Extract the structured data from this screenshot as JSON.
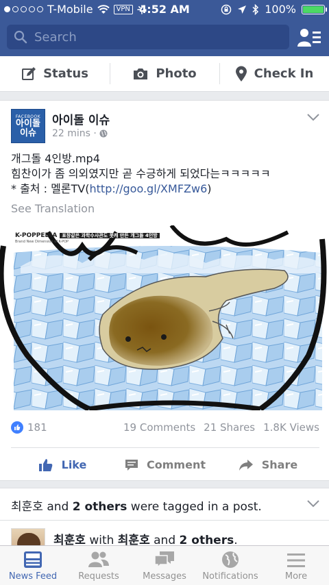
{
  "status_bar": {
    "carrier": "T-Mobile",
    "vpn": "VPN",
    "time": "4:52 AM",
    "battery": "100%"
  },
  "search": {
    "placeholder": "Search"
  },
  "composer": {
    "status": "Status",
    "photo": "Photo",
    "check_in": "Check In"
  },
  "post": {
    "avatar_lines": [
      "FACEBOOK",
      "아이돌",
      "이슈"
    ],
    "page_name": "아이돌 이슈",
    "time": "22 mins ·",
    "body_line1": "개그돌 4인방.mp4",
    "body_line2": "힘찬이가 좀 의외였지만 곧 수긍하게 되었다는ㅋㅋㅋㅋㅋ",
    "body_line3_prefix": "* 출처 : 멜론TV(",
    "body_link": "http://goo.gl/XMFZw6",
    "body_line3_suffix": ")",
    "see_translation": "See Translation",
    "image_brand": "K-POPPEDIA",
    "image_caption": "표창같은 과학수사관도 못캐 만든 개그돌 4인방",
    "image_subtitle": "Brand New Dimension of K-POP",
    "likes": "181",
    "comments": "19 Comments",
    "shares": "21 Shares",
    "views": "1.8K Views",
    "like_label": "Like",
    "comment_label": "Comment",
    "share_label": "Share"
  },
  "story2": {
    "name": "최훈호",
    "tag_mid": " and ",
    "others": "2 others",
    "tag_end": " were tagged in a post.",
    "with_name": "최훈호",
    "with_word": " with ",
    "with_name2": "최훈호",
    "with_and": " and ",
    "with_others": "2 others",
    "with_end": "."
  },
  "tabs": [
    {
      "label": "News Feed",
      "icon": "news-feed-icon"
    },
    {
      "label": "Requests",
      "icon": "requests-icon"
    },
    {
      "label": "Messages",
      "icon": "messages-icon"
    },
    {
      "label": "Notifications",
      "icon": "globe-icon"
    },
    {
      "label": "More",
      "icon": "hamburger-icon"
    }
  ],
  "colors": {
    "brand": "#3b5998",
    "link": "#365899",
    "active_tab": "#4267b2",
    "like_badge": "#4080ff"
  }
}
